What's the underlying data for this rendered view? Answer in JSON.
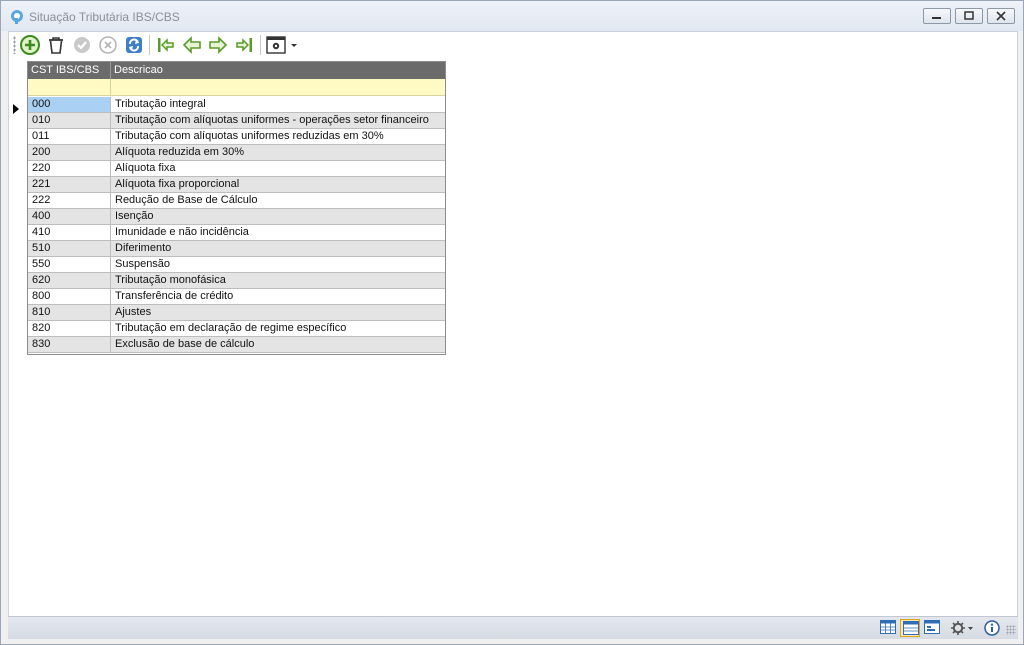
{
  "window": {
    "title": "Situação Tributária IBS/CBS"
  },
  "toolbar": {
    "buttons": [
      {
        "name": "add-icon"
      },
      {
        "name": "delete-icon"
      },
      {
        "name": "confirm-icon"
      },
      {
        "name": "cancel-icon"
      },
      {
        "name": "refresh-icon"
      },
      {
        "name": "first-record-icon"
      },
      {
        "name": "previous-record-icon"
      },
      {
        "name": "next-record-icon"
      },
      {
        "name": "last-record-icon"
      },
      {
        "name": "settings-menu-icon"
      }
    ]
  },
  "grid": {
    "columns": [
      "CST IBS/CBS",
      "Descricao"
    ],
    "rows": [
      {
        "code": "000",
        "desc": "Tributação integral"
      },
      {
        "code": "010",
        "desc": "Tributação com alíquotas uniformes - operações setor financeiro"
      },
      {
        "code": "011",
        "desc": "Tributação com alíquotas uniformes reduzidas em 30%"
      },
      {
        "code": "200",
        "desc": "Alíquota reduzida em 30%"
      },
      {
        "code": "220",
        "desc": "Alíquota fixa"
      },
      {
        "code": "221",
        "desc": "Alíquota fixa proporcional"
      },
      {
        "code": "222",
        "desc": "Redução de Base de Cálculo"
      },
      {
        "code": "400",
        "desc": "Isenção"
      },
      {
        "code": "410",
        "desc": "Imunidade e não incidência"
      },
      {
        "code": "510",
        "desc": "Diferimento"
      },
      {
        "code": "550",
        "desc": "Suspensão"
      },
      {
        "code": "620",
        "desc": "Tributação monofásica"
      },
      {
        "code": "800",
        "desc": "Transferência de crédito"
      },
      {
        "code": "810",
        "desc": "Ajustes"
      },
      {
        "code": "820",
        "desc": "Tributação em declaração de regime específico"
      },
      {
        "code": "830",
        "desc": "Exclusão de base de cálculo"
      }
    ]
  },
  "colors": {
    "header_bg": "#6b6b6b",
    "filter_bg": "#fff9c4",
    "selection": "#aad1f3",
    "alt_row": "#e4e4e4"
  }
}
